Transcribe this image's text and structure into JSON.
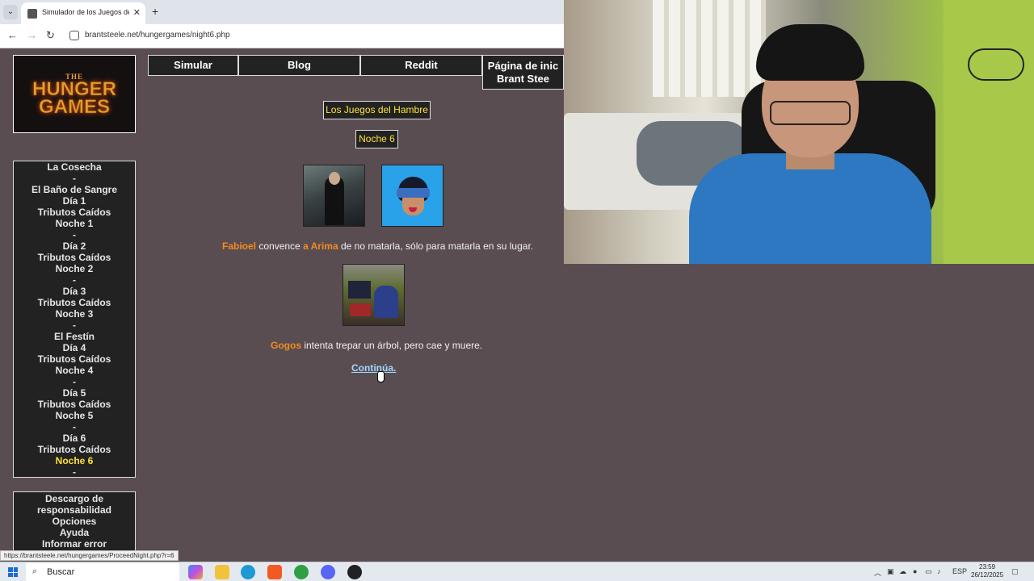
{
  "browser": {
    "tab_title": "Simulador de los Juegos del Ha",
    "url": "brantsteele.net/hungergames/night6.php",
    "status_url": "https://brantsteele.net/hungergames/ProceedNight.php?r=6"
  },
  "logo": {
    "line0": "THE",
    "line1": "HUNGER",
    "line2": "GAMES"
  },
  "topnav": {
    "simular": "Simular",
    "blog": "Blog",
    "reddit": "Reddit",
    "home_line1": "Página de inic",
    "home_line2": "Brant Stee"
  },
  "sidenav": [
    {
      "label": "La Cosecha",
      "current": false
    },
    {
      "label": "-",
      "current": false
    },
    {
      "label": "El Baño de Sangre",
      "current": false
    },
    {
      "label": "Día 1",
      "current": false
    },
    {
      "label": "Tributos Caídos",
      "current": false
    },
    {
      "label": "Noche 1",
      "current": false
    },
    {
      "label": "-",
      "current": false
    },
    {
      "label": "Día 2",
      "current": false
    },
    {
      "label": "Tributos Caídos",
      "current": false
    },
    {
      "label": "Noche 2",
      "current": false
    },
    {
      "label": "-",
      "current": false
    },
    {
      "label": "Día 3",
      "current": false
    },
    {
      "label": "Tributos Caídos",
      "current": false
    },
    {
      "label": "Noche 3",
      "current": false
    },
    {
      "label": "-",
      "current": false
    },
    {
      "label": "El Festín",
      "current": false
    },
    {
      "label": "Día 4",
      "current": false
    },
    {
      "label": "Tributos Caídos",
      "current": false
    },
    {
      "label": "Noche 4",
      "current": false
    },
    {
      "label": "-",
      "current": false
    },
    {
      "label": "Día 5",
      "current": false
    },
    {
      "label": "Tributos Caídos",
      "current": false
    },
    {
      "label": "Noche 5",
      "current": false
    },
    {
      "label": "-",
      "current": false
    },
    {
      "label": "Día 6",
      "current": false
    },
    {
      "label": "Tributos Caídos",
      "current": false
    },
    {
      "label": "Noche 6",
      "current": true
    },
    {
      "label": "-",
      "current": false
    }
  ],
  "sidenav2": {
    "disclaimer_1": "Descargo de",
    "disclaimer_2": "responsabilidad",
    "options": "Opciones",
    "help": "Ayuda",
    "report": "Informar error"
  },
  "main": {
    "title": "Los Juegos del Hambre",
    "night": "Noche 6",
    "event1": {
      "name1": "Fabioel",
      "text1": " convence ",
      "name2": "a Arima",
      "text2": " de no matarla, sólo para matarla en su lugar."
    },
    "event2": {
      "name": "Gogos",
      "text": " intenta trepar un árbol, pero cae y muere."
    },
    "continue": "Continúa."
  },
  "taskbar": {
    "search": "Buscar",
    "lang": "ESP",
    "time": "23:59",
    "date": "26/12/2025"
  },
  "colors": {
    "page_bg": "#5a4d52",
    "panel_bg": "#222222",
    "highlight": "#ffe13a",
    "tribute_name": "#f28c1e",
    "link": "#9fd9ff"
  }
}
